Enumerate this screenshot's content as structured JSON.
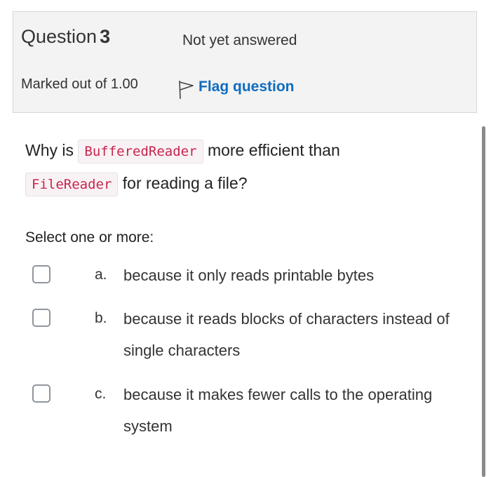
{
  "question": {
    "label": "Question",
    "number": "3",
    "state": "Not yet answered",
    "grade": "Marked out of 1.00",
    "flag_label": "Flag question"
  },
  "qtext": {
    "part1": "Why is",
    "code1": "BufferedReader",
    "part2": "more efficient than",
    "code2": "FileReader",
    "part3": "for reading a file?"
  },
  "prompt": "Select one or more:",
  "options": [
    {
      "letter": "a.",
      "text": "because it only reads printable bytes",
      "checked": false
    },
    {
      "letter": "b.",
      "text": "because it reads blocks of characters instead of single characters",
      "checked": false
    },
    {
      "letter": "c.",
      "text": "because it makes fewer calls to the operating system",
      "checked": false
    }
  ],
  "colors": {
    "link": "#0f6cbf",
    "code_text": "#c7254e",
    "info_bg": "#f3f3f3"
  }
}
